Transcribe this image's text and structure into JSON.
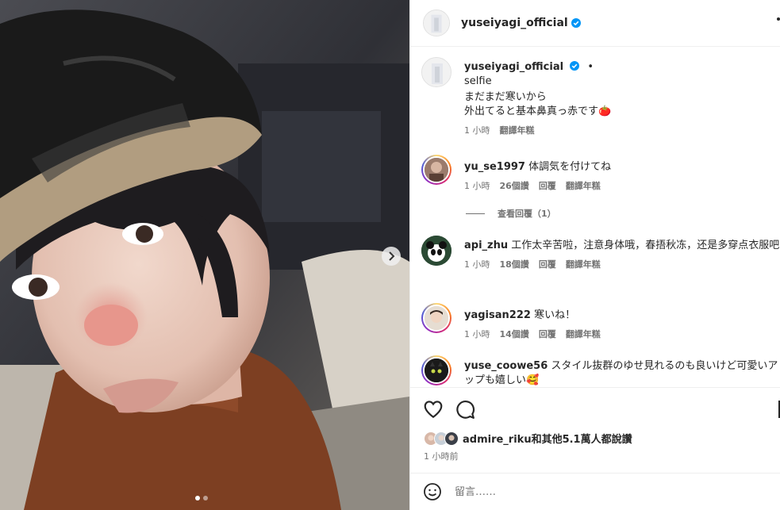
{
  "post": {
    "username": "yuseiyagi_official",
    "caption_title": "selfie",
    "caption_line1": "まだまだ寒いから",
    "caption_line2": "外出てると基本鼻真っ赤です",
    "caption_emoji": "🍅",
    "caption_time": "1 小時",
    "see_translation": "翻譯年糕",
    "separator_dot": "•"
  },
  "comments": [
    {
      "username": "yu_se1997",
      "text": "体調気を付けてね",
      "time": "1 小時",
      "likes": "26個讚",
      "reply": "回覆",
      "translate": "翻譯年糕",
      "view_replies": "查看回覆（1）"
    },
    {
      "username": "api_zhu",
      "text": "工作太辛苦啦，注意身体哦，春捂秋冻，还是多穿点衣服吧",
      "time": "1 小時",
      "likes": "18個讚",
      "reply": "回覆",
      "translate": "翻譯年糕"
    },
    {
      "username": "yagisan222",
      "text": "寒いね！",
      "time": "1 小時",
      "likes": "14個讚",
      "reply": "回覆",
      "translate": "翻譯年糕"
    },
    {
      "username": "yuse_coowe56",
      "text": "スタイル抜群のゆせ見れるのも良いけど可愛いアップも嬉しい",
      "emoji": "🥰"
    }
  ],
  "likes_summary": "admire_riku和其他5.1萬人都說讚",
  "post_time": "1 小時前",
  "comment_placeholder": "留言……",
  "icons": {
    "verified": "verified-badge-icon",
    "like": "heart-icon",
    "comment": "comment-icon",
    "save": "bookmark-icon",
    "emoji": "smiley-icon",
    "next": "chevron-right-icon"
  },
  "colors": {
    "verified": "#0095f6",
    "meta": "#737373",
    "text": "#262626"
  },
  "carousel": {
    "count": 2,
    "active": 1
  }
}
